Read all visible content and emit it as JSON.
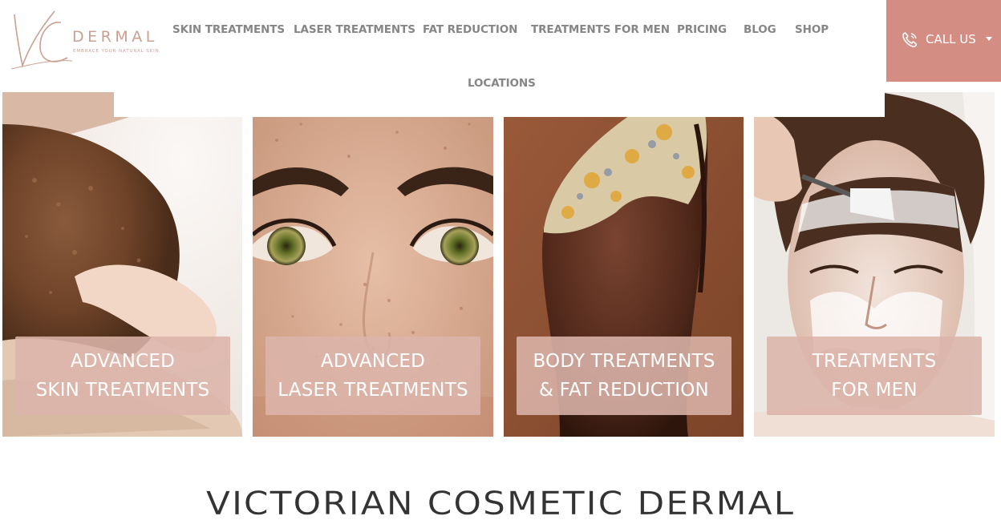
{
  "brand": {
    "monogram": "VC",
    "wordmark": "DERMAL",
    "tagline": "EMBRACE YOUR NATURAL SKIN",
    "accent_color": "#d48d83",
    "logo_color": "#c9a193"
  },
  "nav": {
    "items": [
      {
        "label": "SKIN TREATMENTS"
      },
      {
        "label": "LASER TREATMENTS"
      },
      {
        "label": "FAT REDUCTION"
      },
      {
        "label": "TREATMENTS FOR MEN"
      },
      {
        "label": "PRICING"
      },
      {
        "label": "BLOG"
      },
      {
        "label": "SHOP"
      },
      {
        "label": "LOCATIONS"
      }
    ],
    "call": {
      "label": "CALL US",
      "icon": "phone-icon"
    }
  },
  "tiles": [
    {
      "line1": "ADVANCED",
      "line2": "SKIN TREATMENTS"
    },
    {
      "line1": "ADVANCED",
      "line2": "LASER TREATMENTS"
    },
    {
      "line1": "BODY TREATMENTS",
      "line2": "& FAT REDUCTION"
    },
    {
      "line1": "TREATMENTS",
      "line2": "FOR MEN"
    }
  ],
  "heading": "VICTORIAN COSMETIC DERMAL"
}
